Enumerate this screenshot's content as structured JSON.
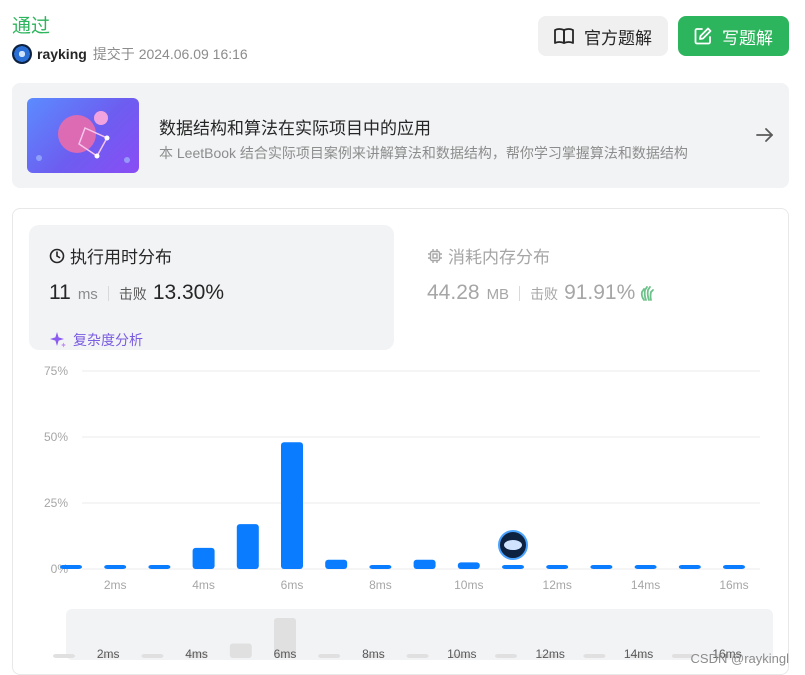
{
  "header": {
    "status": "通过",
    "user": "rayking",
    "submitted_text": "提交于 2024.06.09 16:16",
    "official_solution_label": "官方题解",
    "write_solution_label": "写题解"
  },
  "banner": {
    "title": "数据结构和算法在实际项目中的应用",
    "subtitle": "本 LeetBook 结合实际项目案例来讲解算法和数据结构，帮你学习掌握算法和数据结构"
  },
  "runtime": {
    "title": "执行用时分布",
    "value": "11",
    "unit": "ms",
    "beats_label": "击败",
    "beats_pct": "13.30%",
    "complexity_label": "复杂度分析"
  },
  "memory": {
    "title": "消耗内存分布",
    "value": "44.28",
    "unit": "MB",
    "beats_label": "击败",
    "beats_pct": "91.91%"
  },
  "chart_data": {
    "type": "bar",
    "categories": [
      "1ms",
      "2ms",
      "3ms",
      "4ms",
      "5ms",
      "6ms",
      "7ms",
      "8ms",
      "9ms",
      "10ms",
      "11ms",
      "12ms",
      "13ms",
      "14ms",
      "15ms",
      "16ms"
    ],
    "values": [
      1.5,
      1.5,
      1.5,
      8,
      17,
      48,
      3.5,
      1.5,
      3.5,
      2.5,
      1.5,
      1.5,
      1.5,
      1.5,
      1.5,
      1.5
    ],
    "overview_values": [
      0.5,
      0.5,
      0.5,
      1.5,
      4,
      11,
      0.5,
      0.5,
      0.5,
      0.5,
      0.5,
      0.5,
      0.5,
      0.5,
      0.5,
      0.5
    ],
    "ylim": [
      0,
      75
    ],
    "y_ticks": [
      "0%",
      "25%",
      "50%",
      "75%"
    ],
    "x_ticks": [
      "2ms",
      "4ms",
      "6ms",
      "8ms",
      "10ms",
      "12ms",
      "14ms",
      "16ms"
    ],
    "highlight_category": "11ms",
    "grid": true,
    "bar_color": "#0a7cff",
    "overview_color": "#e0e0e0"
  },
  "watermark": "CSDN @raykingl"
}
